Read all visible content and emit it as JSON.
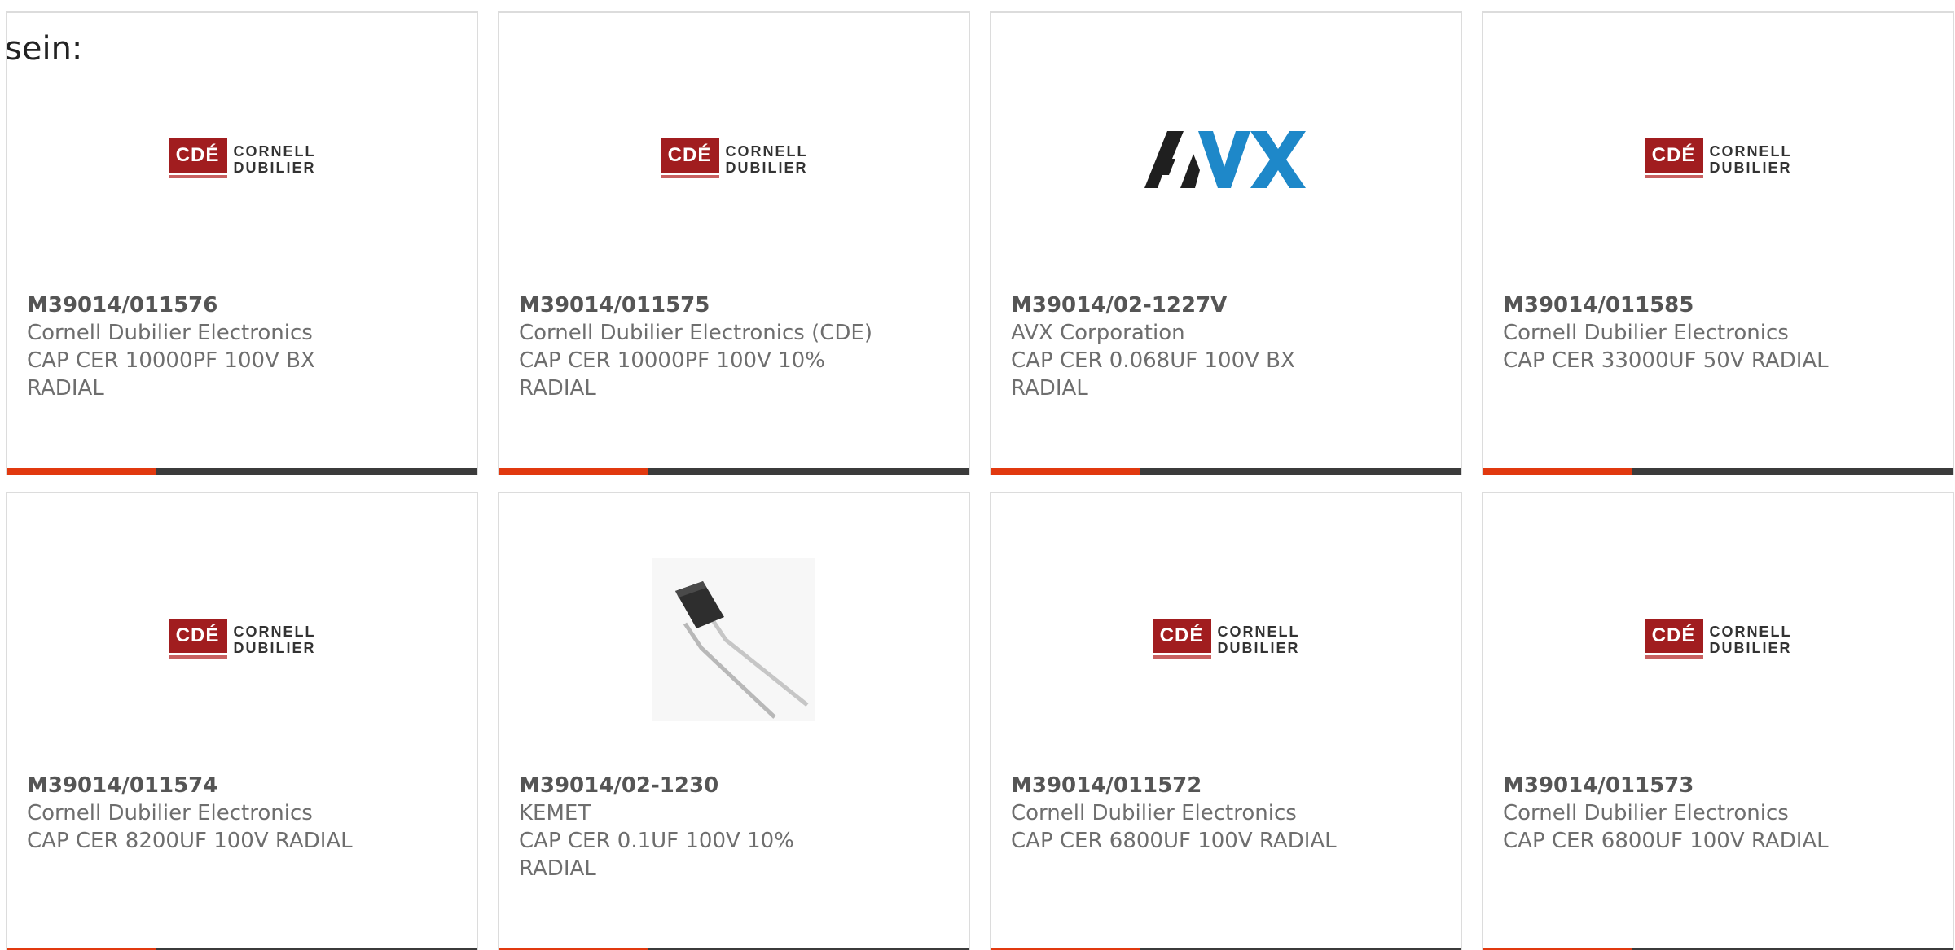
{
  "intro_text": "sein:",
  "colors": {
    "accent": "#e1390f",
    "bar": "#3b3b3b",
    "cde_red": "#a11d1f",
    "avx_dark": "#1f1f1f",
    "avx_blue": "#1e88c9"
  },
  "products": [
    {
      "part_number": "M39014/011576",
      "manufacturer": "Cornell Dubilier Electronics",
      "description_line1": "CAP CER 10000PF 100V BX",
      "description_line2": "RADIAL",
      "image": "cde-logo"
    },
    {
      "part_number": "M39014/011575",
      "manufacturer": "Cornell Dubilier Electronics (CDE)",
      "description_line1": "CAP CER 10000PF 100V 10%",
      "description_line2": "RADIAL",
      "image": "cde-logo"
    },
    {
      "part_number": "M39014/02-1227V",
      "manufacturer": "AVX Corporation",
      "description_line1": "CAP CER 0.068UF 100V BX",
      "description_line2": "RADIAL",
      "image": "avx-logo"
    },
    {
      "part_number": "M39014/011585",
      "manufacturer": "Cornell Dubilier Electronics",
      "description_line1": "CAP CER 33000UF 50V RADIAL",
      "description_line2": "",
      "image": "cde-logo"
    },
    {
      "part_number": "M39014/011574",
      "manufacturer": "Cornell Dubilier Electronics",
      "description_line1": "CAP CER 8200UF 100V RADIAL",
      "description_line2": "",
      "image": "cde-logo"
    },
    {
      "part_number": "M39014/02-1230",
      "manufacturer": "KEMET",
      "description_line1": "CAP CER 0.1UF 100V 10%",
      "description_line2": "RADIAL",
      "image": "capacitor-photo"
    },
    {
      "part_number": "M39014/011572",
      "manufacturer": "Cornell Dubilier Electronics",
      "description_line1": "CAP CER 6800UF 100V RADIAL",
      "description_line2": "",
      "image": "cde-logo"
    },
    {
      "part_number": "M39014/011573",
      "manufacturer": "Cornell Dubilier Electronics",
      "description_line1": "CAP CER 6800UF 100V RADIAL",
      "description_line2": "",
      "image": "cde-logo"
    }
  ],
  "logos": {
    "cde_mark": "CDÉ",
    "cde_word1": "CORNELL",
    "cde_word2": "DUBILIER"
  }
}
